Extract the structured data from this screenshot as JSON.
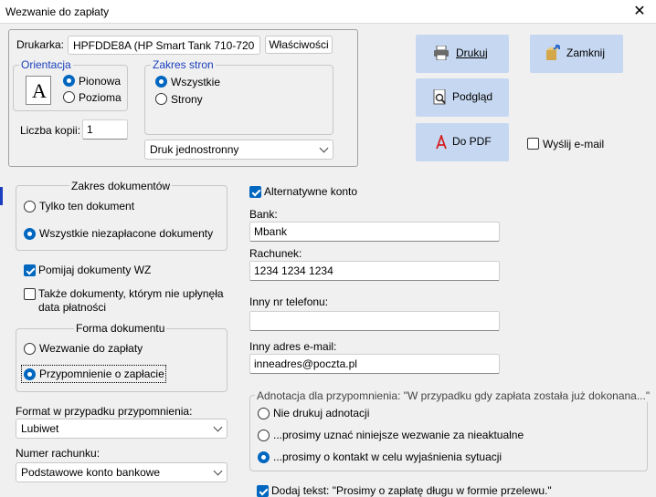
{
  "window": {
    "title": "Wezwanie do zapłaty"
  },
  "printer": {
    "label": "Drukarka:",
    "value": "HPFDDE8A (HP Smart Tank 710-720",
    "properties_label": "Właściwości",
    "orientation": {
      "legend": "Orientacja",
      "portrait": "Pionowa",
      "landscape": "Pozioma",
      "selected": "Pionowa",
      "icon_glyph": "A"
    },
    "page_range": {
      "legend": "Zakres stron",
      "all": "Wszystkie",
      "pages": "Strony",
      "selected": "Wszystkie"
    },
    "copies_label": "Liczba kopii:",
    "copies_value": "1",
    "duplex_value": "Druk jednostronny"
  },
  "actions": {
    "print": "Drukuj",
    "close": "Zamknij",
    "preview": "Podgląd",
    "pdf": "Do PDF",
    "send_email": "Wyślij e-mail",
    "send_email_checked": false
  },
  "documents_range": {
    "legend": "Zakres dokumentów",
    "only_this": "Tylko ten dokument",
    "all_unpaid": "Wszystkie niezapłacone dokumenty",
    "selected": "Wszystkie niezapłacone dokumenty"
  },
  "skip_wz": {
    "label": "Pomijaj dokumenty WZ",
    "checked": true
  },
  "not_due": {
    "label_line1": "Także dokumenty, którym nie upłynęła",
    "label_line2": "data płatności",
    "checked": false
  },
  "document_form": {
    "legend": "Forma dokumentu",
    "demand": "Wezwanie do zapłaty",
    "reminder": "Przypomnienie o zapłacie",
    "selected": "Przypomnienie o zapłacie"
  },
  "reminder_format": {
    "label": "Format w przypadku przypomnienia:",
    "value": "Lubiwet"
  },
  "account_number": {
    "label": "Numer rachunku:",
    "value": "Podstawowe konto bankowe"
  },
  "alt_account": {
    "label": "Alternatywne konto",
    "checked": true,
    "bank_label": "Bank:",
    "bank_value": "Mbank",
    "account_label": "Rachunek:",
    "account_value": "1234 1234 1234"
  },
  "other_phone": {
    "label": "Inny nr telefonu:",
    "value": ""
  },
  "other_email": {
    "label": "Inny adres e-mail:",
    "value": "inneadres@poczta.pl"
  },
  "annotation": {
    "legend": "Adnotacja dla przypomnienia: \"W przypadku gdy zapłata została już dokonana...\"",
    "no_print": "Nie drukuj adnotacji",
    "opt_void": "...prosimy uznać niniejsze wezwanie za nieaktualne",
    "opt_contact": "...prosimy o kontakt w celu wyjaśnienia sytuacji",
    "selected": "...prosimy o kontakt w celu wyjaśnienia sytuacji"
  },
  "add_text": {
    "label": "Dodaj tekst: \"Prosimy o zapłatę długu w formie przelewu.\"",
    "checked": true
  }
}
